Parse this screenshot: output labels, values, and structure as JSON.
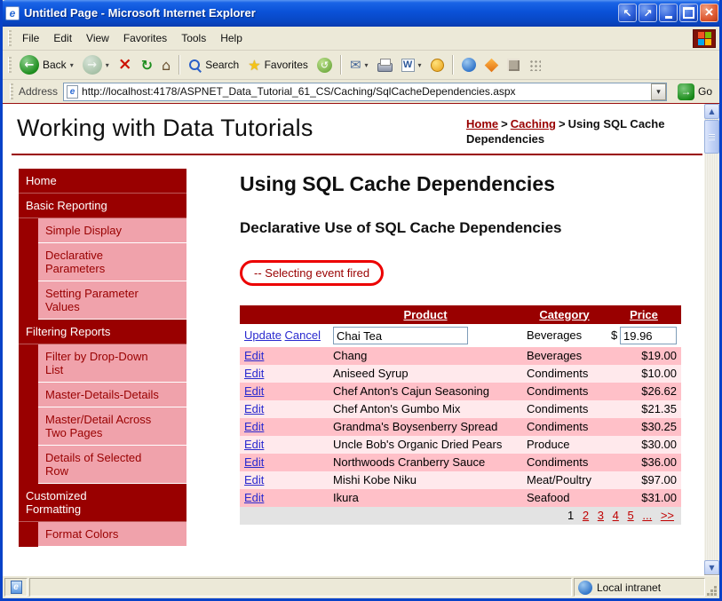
{
  "window": {
    "title": "Untitled Page - Microsoft Internet Explorer"
  },
  "menu": {
    "items": [
      "File",
      "Edit",
      "View",
      "Favorites",
      "Tools",
      "Help"
    ]
  },
  "toolbar": {
    "back": "Back",
    "search": "Search",
    "favorites": "Favorites"
  },
  "address": {
    "label": "Address",
    "url": "http://localhost:4178/ASPNET_Data_Tutorial_61_CS/Caching/SqlCacheDependencies.aspx",
    "go": "Go"
  },
  "header": {
    "site_title": "Working with Data Tutorials",
    "breadcrumb": {
      "home": "Home",
      "sep1": ">",
      "section": "Caching",
      "sep2": ">",
      "current": "Using SQL Cache Dependencies"
    }
  },
  "sidebar": {
    "items": [
      "Home",
      "Basic Reporting",
      "Simple Display",
      "Declarative Parameters",
      "Setting Parameter Values",
      "Filtering Reports",
      "Filter by Drop-Down List",
      "Master-Details-Details",
      "Master/Detail Across Two Pages",
      "Details of Selected Row",
      "Customized Formatting",
      "Format Colors"
    ]
  },
  "main": {
    "title": "Using SQL Cache Dependencies",
    "subtitle": "Declarative Use of SQL Cache Dependencies",
    "event_message": "-- Selecting event fired",
    "table": {
      "headers": {
        "product": "Product",
        "category": "Category",
        "price": "Price"
      },
      "edit_label": "Edit",
      "edit_row": {
        "update": "Update",
        "cancel": "Cancel",
        "product": "Chai Tea",
        "category": "Beverages",
        "currency": "$",
        "price": "19.96"
      },
      "rows": [
        {
          "product": "Chang",
          "category": "Beverages",
          "price": "$19.00"
        },
        {
          "product": "Aniseed Syrup",
          "category": "Condiments",
          "price": "$10.00"
        },
        {
          "product": "Chef Anton's Cajun Seasoning",
          "category": "Condiments",
          "price": "$26.62"
        },
        {
          "product": "Chef Anton's Gumbo Mix",
          "category": "Condiments",
          "price": "$21.35"
        },
        {
          "product": "Grandma's Boysenberry Spread",
          "category": "Condiments",
          "price": "$30.25"
        },
        {
          "product": "Uncle Bob's Organic Dried Pears",
          "category": "Produce",
          "price": "$30.00"
        },
        {
          "product": "Northwoods Cranberry Sauce",
          "category": "Condiments",
          "price": "$36.00"
        },
        {
          "product": "Mishi Kobe Niku",
          "category": "Meat/Poultry",
          "price": "$97.00"
        },
        {
          "product": "Ikura",
          "category": "Seafood",
          "price": "$31.00"
        }
      ],
      "pager": {
        "current": "1",
        "pages": [
          "2",
          "3",
          "4",
          "5",
          "...",
          ">>"
        ]
      }
    }
  },
  "statusbar": {
    "zone": "Local intranet"
  }
}
